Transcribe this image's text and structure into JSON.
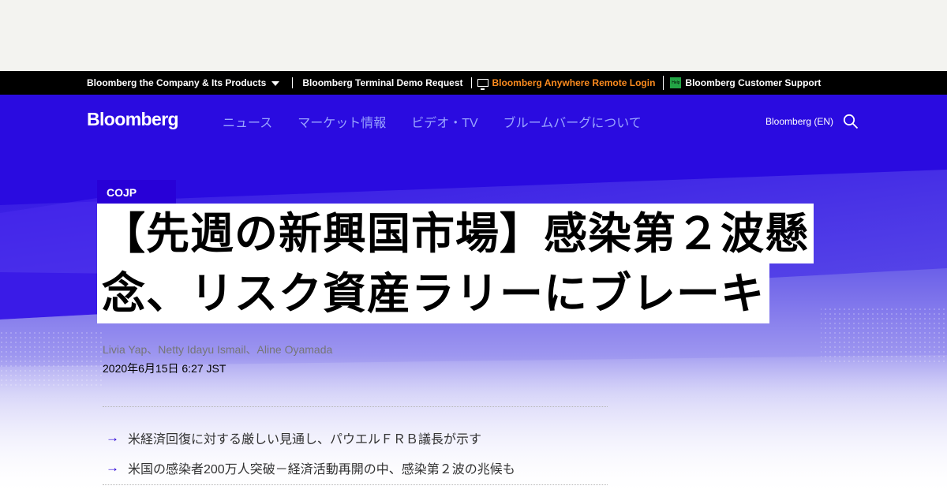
{
  "utility_bar": {
    "company_products": "Bloomberg the Company & Its Products",
    "terminal_demo": "Bloomberg Terminal Demo Request",
    "anywhere_login": "Bloomberg Anywhere Remote Login",
    "customer_support": "Bloomberg Customer Support",
    "help_icon_text": "Help"
  },
  "nav": {
    "logo": "Bloomberg",
    "links": [
      "ニュース",
      "マーケット情報",
      "ビデオ・TV",
      "ブルームバーグについて"
    ],
    "language": "Bloomberg (EN)"
  },
  "article": {
    "tag": "COJP",
    "headline_line1": "【先週の新興国市場】感染第２波懸",
    "headline_line2": "念、リスク資産ラリーにブレーキ",
    "authors": "Livia Yap、Netty Idayu Ismail、Aline Oyamada",
    "date": "2020年6月15日 6:27 JST",
    "bullets": [
      "米経済回復に対する厳しい見通し、パウエルＦＲＢ議長が示す",
      "米国の感染者200万人突破－経済活動再開の中、感染第２波の兆候も"
    ]
  },
  "colors": {
    "brand_blue": "#2800d7",
    "hero_top": "#2a0be0",
    "anywhere_orange": "#fb8b1e",
    "support_green": "#23a445"
  },
  "icons": {
    "dropdown": "chevron-down-icon",
    "anywhere": "monitor-icon",
    "support": "help-icon",
    "search": "search-icon",
    "bullet": "arrow-right-icon"
  }
}
